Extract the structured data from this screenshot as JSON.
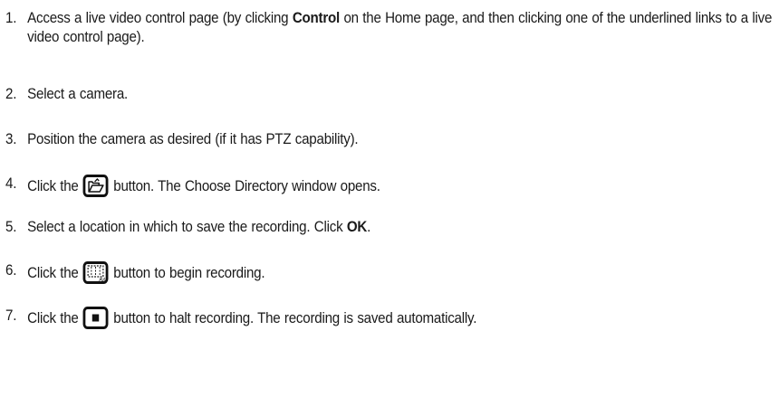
{
  "steps": [
    {
      "number": "1.",
      "parts": [
        {
          "text": "Access a live video control page (by clicking "
        },
        {
          "text": "Control",
          "bold": true
        },
        {
          "text": " on the Home page, and then clicking one of the underlined links to a live video control page)."
        }
      ]
    },
    {
      "number": "2.",
      "parts": [
        {
          "text": "Select a camera."
        }
      ]
    },
    {
      "number": "3.",
      "parts": [
        {
          "text": "Position the camera as desired (if it has PTZ capability)."
        }
      ]
    },
    {
      "number": "4.",
      "parts": [
        {
          "text": "Click the "
        },
        {
          "icon": "choose-directory-icon"
        },
        {
          "text": " button. The Choose Directory window opens."
        }
      ]
    },
    {
      "number": "5.",
      "parts": [
        {
          "text": "Select a location in which to save the recording. Click "
        },
        {
          "text": "OK",
          "bold": true
        },
        {
          "text": "."
        }
      ]
    },
    {
      "number": "6.",
      "parts": [
        {
          "text": "Click the "
        },
        {
          "icon": "avi-record-icon",
          "icon_label": "AVI"
        },
        {
          "text": " button to begin recording."
        }
      ]
    },
    {
      "number": "7.",
      "parts": [
        {
          "text": "Click the "
        },
        {
          "icon": "stop-icon"
        },
        {
          "text": " button to halt recording. The recording is saved automatically."
        }
      ]
    }
  ]
}
